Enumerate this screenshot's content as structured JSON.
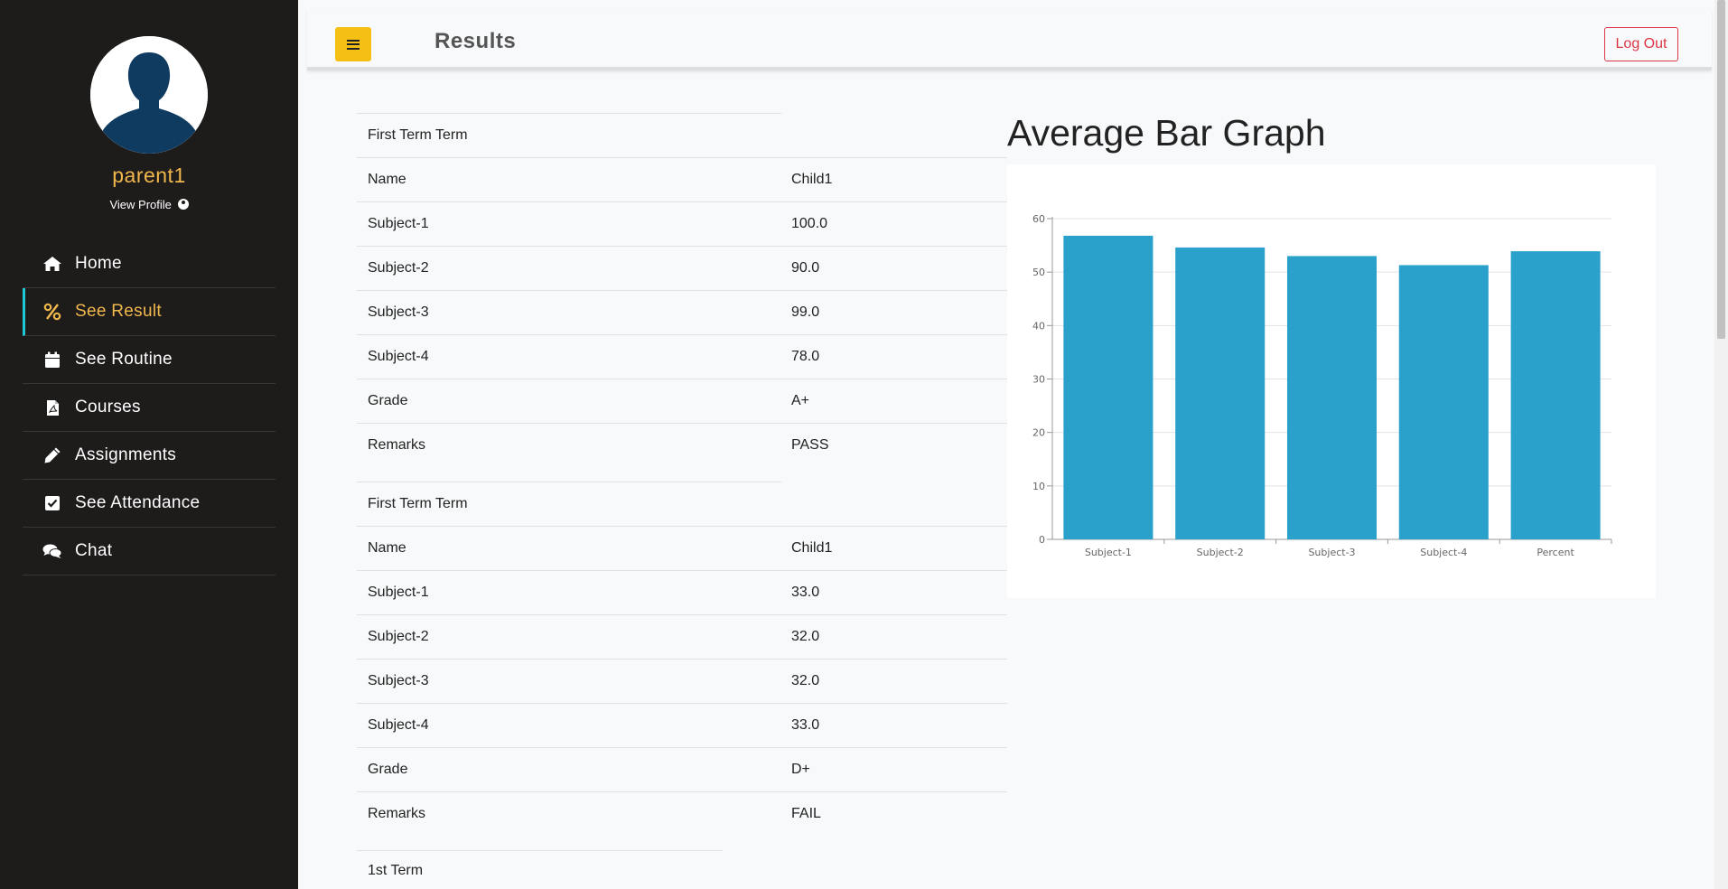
{
  "sidebar": {
    "username": "parent1",
    "view_profile": "View Profile",
    "items": [
      {
        "label": "Home",
        "icon": "home-icon"
      },
      {
        "label": "See Result",
        "icon": "percent-icon",
        "active": true
      },
      {
        "label": "See Routine",
        "icon": "calendar-icon"
      },
      {
        "label": "Courses",
        "icon": "file-pdf-icon"
      },
      {
        "label": "Assignments",
        "icon": "pencil-icon"
      },
      {
        "label": "See Attendance",
        "icon": "check-square-icon"
      },
      {
        "label": "Chat",
        "icon": "comments-icon"
      }
    ]
  },
  "topbar": {
    "title": "Results",
    "logout_label": "Log Out"
  },
  "results": [
    {
      "term": "First Term Term",
      "rows": [
        {
          "label": "Name",
          "value": "Child1"
        },
        {
          "label": "Subject-1",
          "value": "100.0"
        },
        {
          "label": "Subject-2",
          "value": "90.0"
        },
        {
          "label": "Subject-3",
          "value": "99.0"
        },
        {
          "label": "Subject-4",
          "value": "78.0"
        },
        {
          "label": "Grade",
          "value": "A+"
        },
        {
          "label": "Remarks",
          "value": "PASS"
        }
      ]
    },
    {
      "term": "First Term Term",
      "rows": [
        {
          "label": "Name",
          "value": "Child1"
        },
        {
          "label": "Subject-1",
          "value": "33.0"
        },
        {
          "label": "Subject-2",
          "value": "32.0"
        },
        {
          "label": "Subject-3",
          "value": "32.0"
        },
        {
          "label": "Subject-4",
          "value": "33.0"
        },
        {
          "label": "Grade",
          "value": "D+"
        },
        {
          "label": "Remarks",
          "value": "FAIL"
        }
      ]
    }
  ],
  "next_term": "1st Term",
  "chart_data": {
    "type": "bar",
    "title": "Average Bar Graph",
    "categories": [
      "Subject-1",
      "Subject-2",
      "Subject-3",
      "Subject-4",
      "Percent"
    ],
    "values": [
      56.8,
      54.6,
      53,
      51.3,
      53.9
    ],
    "ylim": [
      0,
      60
    ],
    "yticks": [
      0,
      10,
      20,
      30,
      40,
      50,
      60
    ],
    "grid": true,
    "color": "#2aa1cb"
  },
  "colors": {
    "sidebar_bg": "#1e1b1b",
    "accent": "#f0b84c",
    "menu_button": "#f5bf13",
    "logout": "#dc3545",
    "active_indicator": "#1fc8d6",
    "bar": "#2aa1cb"
  }
}
